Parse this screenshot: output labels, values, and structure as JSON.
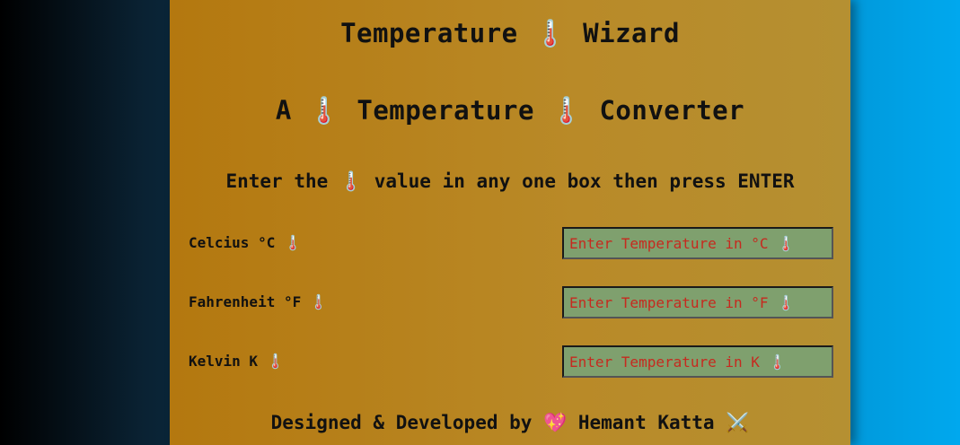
{
  "header": {
    "title": "Temperature 🌡️ Wizard",
    "subtitle": "A 🌡️ Temperature 🌡️ Converter",
    "instruction": "Enter the 🌡️ value in any one box then press ENTER"
  },
  "fields": [
    {
      "label": "Celcius °C 🌡️",
      "value": "",
      "placeholder": "Enter Temperature in °C 🌡️"
    },
    {
      "label": "Fahrenheit °F 🌡️",
      "value": "",
      "placeholder": "Enter Temperature in °F 🌡️"
    },
    {
      "label": "Kelvin K 🌡️",
      "value": "",
      "placeholder": "Enter Temperature in K 🌡️"
    }
  ],
  "footer": {
    "credit": "Designed & Developed by 💖 Hemant Katta ⚔️"
  },
  "icons": [
    "thermometer-icon",
    "heart-icon",
    "crossed-swords-icon"
  ],
  "colors": {
    "card_background": "#b98a28",
    "input_background": "#7fa06e",
    "input_text": "#c62a1f",
    "heading_text": "#111111",
    "page_gradient_left": "#000000",
    "page_gradient_right": "#00a8ee"
  }
}
